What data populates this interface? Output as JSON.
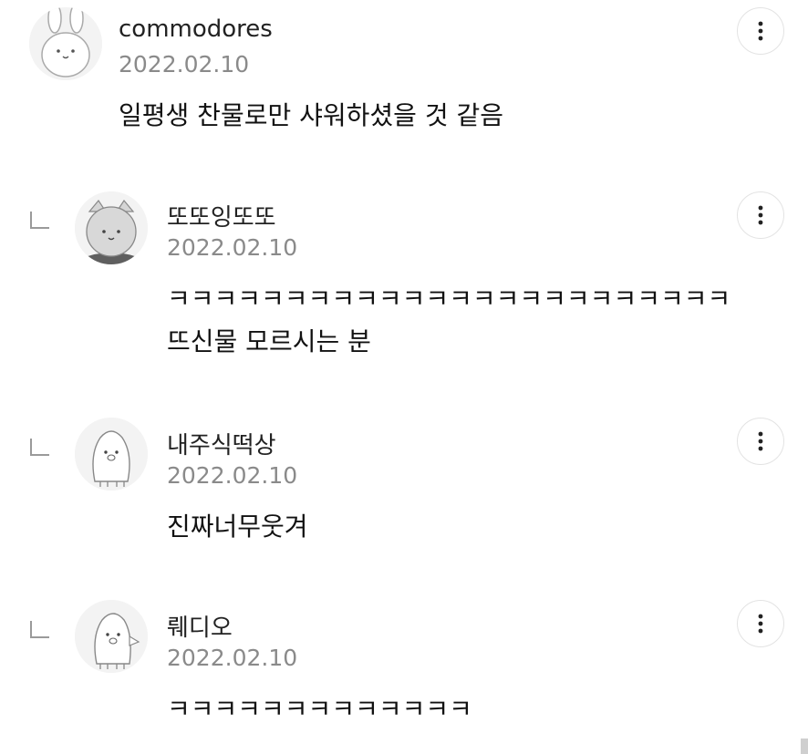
{
  "comments": [
    {
      "nickname": "commodores",
      "date": "2022.02.10",
      "text": "일평생 찬물로만 샤워하셨을 것 같음",
      "avatar_icon": "rabbit-avatar-icon",
      "is_reply": false
    },
    {
      "nickname": "또또잉또또",
      "date": "2022.02.10",
      "text": "ㅋㅋㅋㅋㅋㅋㅋㅋㅋㅋㅋㅋㅋㅋㅋㅋㅋㅋㅋㅋㅋㅋㅋㅋ\n뜨신물 모르시는 분",
      "avatar_icon": "cat-avatar-icon",
      "is_reply": true
    },
    {
      "nickname": "내주식떡상",
      "date": "2022.02.10",
      "text": "진짜너무웃겨",
      "avatar_icon": "penguin-avatar-icon",
      "is_reply": true
    },
    {
      "nickname": "뤠디오",
      "date": "2022.02.10",
      "text": "ㅋㅋㅋㅋㅋㅋㅋㅋㅋㅋㅋㅋㅋ",
      "avatar_icon": "bird-avatar-icon",
      "is_reply": true
    }
  ],
  "more_icon": "more-vertical-icon",
  "reply_icon": "reply-arrow-icon"
}
